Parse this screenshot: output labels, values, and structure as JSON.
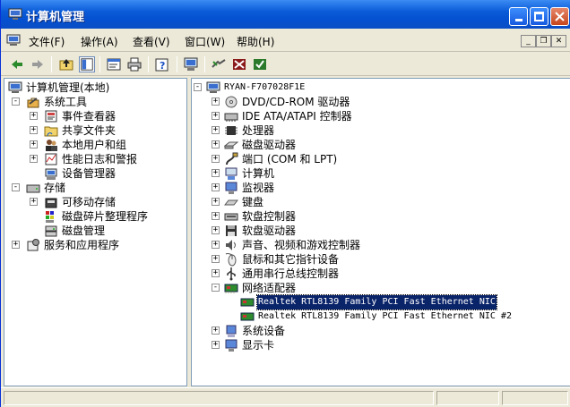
{
  "window": {
    "title": "计算机管理"
  },
  "menu": {
    "file": "文件(F)",
    "action": "操作(A)",
    "view": "查看(V)",
    "window": "窗口(W)",
    "help": "帮助(H)"
  },
  "left_tree": {
    "root": "计算机管理(本地)",
    "system_tools": "系统工具",
    "event_viewer": "事件查看器",
    "shared_folders": "共享文件夹",
    "local_users": "本地用户和组",
    "perf_logs": "性能日志和警报",
    "device_manager": "设备管理器",
    "storage": "存储",
    "removable_storage": "可移动存储",
    "defrag": "磁盘碎片整理程序",
    "disk_mgmt": "磁盘管理",
    "services_apps": "服务和应用程序"
  },
  "right_tree": {
    "computer": "RYAN-F707028F1E",
    "dvd": "DVD/CD-ROM 驱动器",
    "ide": "IDE ATA/ATAPI 控制器",
    "cpu": "处理器",
    "disk": "磁盘驱动器",
    "ports": "端口 (COM 和 LPT)",
    "computer_node": "计算机",
    "monitor": "监视器",
    "keyboard": "键盘",
    "floppy_ctrl": "软盘控制器",
    "floppy_drive": "软盘驱动器",
    "sound": "声音、视频和游戏控制器",
    "mouse": "鼠标和其它指针设备",
    "usb": "通用串行总线控制器",
    "network": "网络适配器",
    "nic1": "Realtek RTL8139 Family PCI Fast Ethernet NIC",
    "nic2": "Realtek RTL8139 Family PCI Fast Ethernet NIC #2",
    "system": "系统设备",
    "display": "显示卡"
  },
  "icons": [
    "back-icon",
    "forward-icon",
    "up-icon",
    "show-hide-tree-icon",
    "properties-icon",
    "print-icon",
    "help-icon",
    "computer-icon",
    "scan-hardware-icon",
    "update-driver-icon",
    "disable-icon"
  ],
  "colors": {
    "title_blue": "#0a5bd8",
    "selection": "#0a246a"
  }
}
